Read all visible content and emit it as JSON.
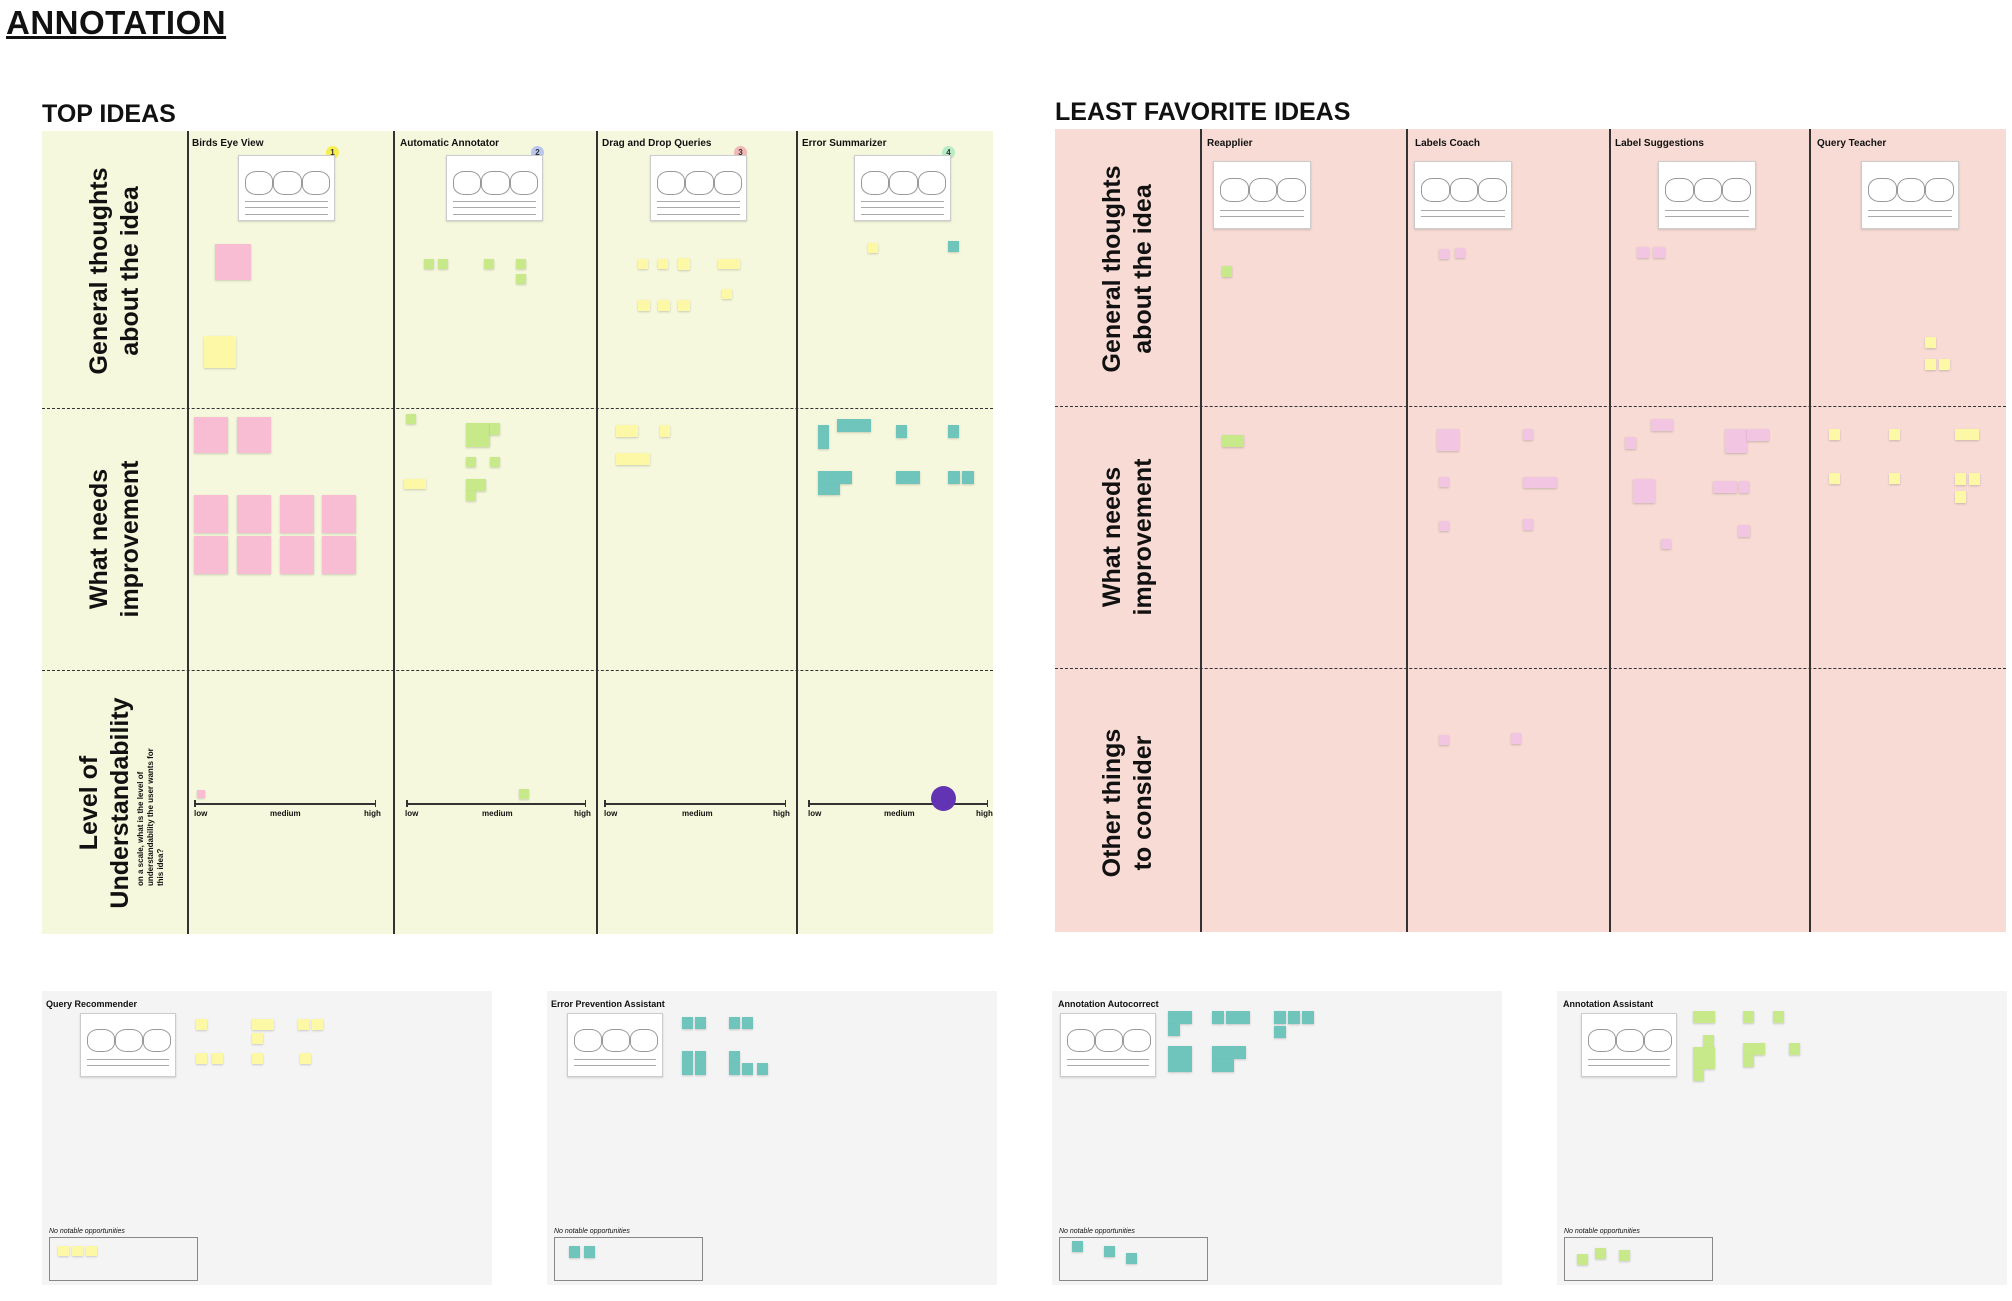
{
  "page": {
    "title": "ANNOTATION"
  },
  "top_ideas": {
    "title": "TOP IDEAS",
    "rows": [
      {
        "label_line1": "General thoughts",
        "label_line2": "about the idea"
      },
      {
        "label_line1": "What needs",
        "label_line2": "improvement"
      },
      {
        "label_line1": "Level of",
        "label_line2": "Understandability",
        "sub": "on a scale, what is the level of understandability the user wants for this idea?"
      }
    ],
    "columns": [
      {
        "title": "Birds Eye View",
        "badge": "1",
        "badge_color": "#f7ef52"
      },
      {
        "title": "Automatic Annotator",
        "badge": "2",
        "badge_color": "#b9c6ef"
      },
      {
        "title": "Drag and Drop Queries",
        "badge": "3",
        "badge_color": "#f2b7b7"
      },
      {
        "title": "Error Summarizer",
        "badge": "4",
        "badge_color": "#b7ecc6"
      }
    ],
    "scale": {
      "low": "low",
      "medium": "medium",
      "high": "high"
    },
    "understandability_levels": [
      0.05,
      0.62,
      null,
      0.73
    ]
  },
  "least_favorite": {
    "title": "LEAST FAVORITE IDEAS",
    "rows": [
      {
        "label_line1": "General thoughts",
        "label_line2": "about the idea"
      },
      {
        "label_line1": "What needs",
        "label_line2": "improvement"
      },
      {
        "label_line1": "Other things",
        "label_line2": "to consider"
      }
    ],
    "columns": [
      {
        "title": "Reapplier"
      },
      {
        "title": "Labels Coach"
      },
      {
        "title": "Label Suggestions"
      },
      {
        "title": "Query Teacher"
      }
    ]
  },
  "bottom_boxes": [
    {
      "title": "Query Recommender",
      "opp_label": "No notable opportunities"
    },
    {
      "title": "Error Prevention Assistant",
      "opp_label": "No notable opportunities"
    },
    {
      "title": "Annotation Autocorrect",
      "opp_label": "No notable opportunities"
    },
    {
      "title": "Annotation Assistant",
      "opp_label": "No notable opportunities"
    }
  ],
  "colors": {
    "top_panel_bg": "#f5f8dc",
    "least_panel_bg": "#f7dbd4",
    "bottom_panel_bg": "#f4f4f4",
    "dot": "#6233b3"
  }
}
